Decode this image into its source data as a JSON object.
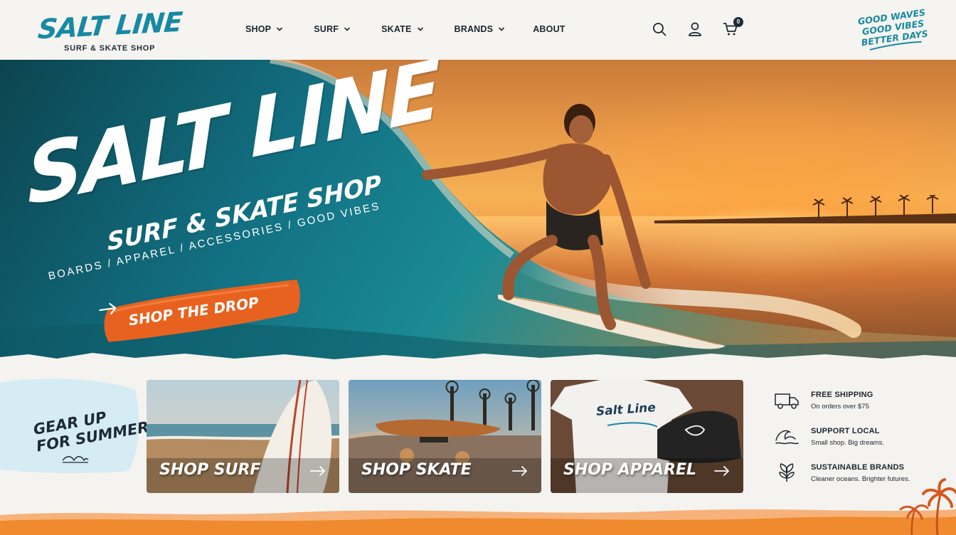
{
  "brand": {
    "name": "SALT LINE",
    "subtitle": "SURF & SKATE SHOP",
    "tagline": [
      "GOOD WAVES",
      "GOOD VIBES",
      "BETTER DAYS"
    ]
  },
  "nav": {
    "items": [
      {
        "label": "SHOP",
        "icon": "chevron-down-icon"
      },
      {
        "label": "SURF",
        "icon": "chevron-down-icon"
      },
      {
        "label": "SKATE",
        "icon": "chevron-down-icon"
      },
      {
        "label": "BRANDS",
        "icon": "chevron-down-icon"
      },
      {
        "label": "ABOUT",
        "icon": ""
      }
    ]
  },
  "header_icons": {
    "search": "search-icon",
    "account": "user-icon",
    "cart": "cart-icon",
    "cart_count": "0"
  },
  "hero": {
    "title": "SALT LINE",
    "subtitle": "SURF & SKATE SHOP",
    "categories": "BOARDS  /  APPAREL  /  ACCESSORIES  /  GOOD VIBES",
    "cta_label": "SHOP THE DROP",
    "cta_icon": "arrow-right-icon"
  },
  "promo": {
    "line1": "GEAR UP",
    "line2": "FOR SUMMER",
    "icon": "wave-icon"
  },
  "tiles": [
    {
      "label": "SHOP SURF",
      "icon": "arrow-right-icon"
    },
    {
      "label": "SHOP SKATE",
      "icon": "arrow-right-icon"
    },
    {
      "label": "SHOP APPAREL",
      "icon": "arrow-right-icon"
    }
  ],
  "tshirt_print": "Salt Line",
  "perks": [
    {
      "title": "FREE SHIPPING",
      "subtitle": "On orders over $75",
      "icon": "truck-icon"
    },
    {
      "title": "SUPPORT LOCAL",
      "subtitle": "Small shop. Big dreams.",
      "icon": "wave-icon"
    },
    {
      "title": "SUSTAINABLE BRANDS",
      "subtitle": "Cleaner oceans. Brighter futures.",
      "icon": "leaf-icon"
    }
  ],
  "colors": {
    "brand_teal": "#1789a3",
    "cta_orange": "#e8621f",
    "ink": "#1c2630",
    "background": "#f4f3ef",
    "sunset_band": "#f08a2e"
  }
}
